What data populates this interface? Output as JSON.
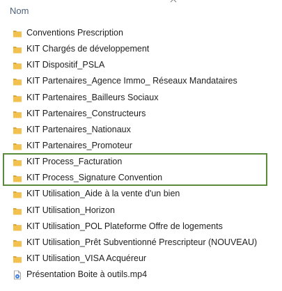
{
  "header": {
    "name_column_label": "Nom",
    "sort_icon": "chevron-up-icon"
  },
  "colors": {
    "folder": "#f2c14e",
    "folder_dark": "#dba73a",
    "highlight_border": "#5b8a3a",
    "header_text": "#4c607a"
  },
  "files": [
    {
      "label": "Conventions Prescription",
      "icon": "folder-icon"
    },
    {
      "label": "KIT Chargés de développement",
      "icon": "folder-icon"
    },
    {
      "label": "KIT Dispositif_PSLA",
      "icon": "folder-icon"
    },
    {
      "label": "KIT Partenaires_Agence Immo_ Réseaux Mandataires",
      "icon": "folder-icon"
    },
    {
      "label": "KIT Partenaires_Bailleurs Sociaux",
      "icon": "folder-icon"
    },
    {
      "label": "KIT Partenaires_Constructeurs",
      "icon": "folder-icon"
    },
    {
      "label": "KIT Partenaires_Nationaux",
      "icon": "folder-icon"
    },
    {
      "label": "KIT Partenaires_Promoteur",
      "icon": "folder-icon"
    },
    {
      "label": "KIT Process_Facturation",
      "icon": "folder-icon"
    },
    {
      "label": "KIT Process_Signature Convention",
      "icon": "folder-icon"
    },
    {
      "label": "KIT Utilisation_Aide à la vente d'un bien",
      "icon": "folder-icon"
    },
    {
      "label": "KIT Utilisation_Horizon",
      "icon": "folder-icon"
    },
    {
      "label": "KIT Utilisation_POL Plateforme Offre de logements",
      "icon": "folder-icon"
    },
    {
      "label": "KIT Utilisation_Prêt Subventionné Prescripteur (NOUVEAU)",
      "icon": "folder-icon"
    },
    {
      "label": "KIT Utilisation_VISA Acquéreur",
      "icon": "folder-icon"
    },
    {
      "label": "Présentation Boite à outils.mp4",
      "icon": "video-file-icon"
    }
  ]
}
